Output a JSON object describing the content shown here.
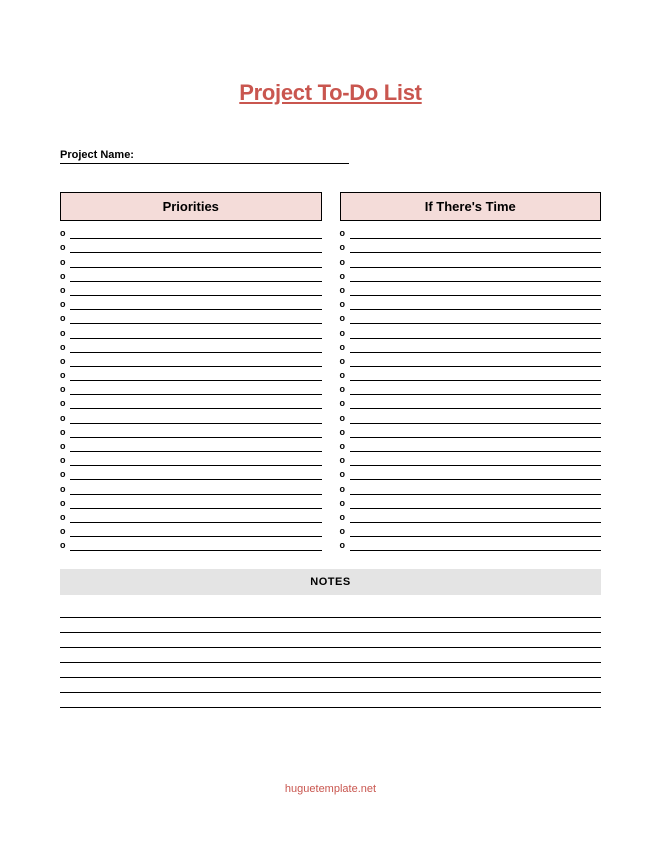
{
  "title": "Project To-Do List",
  "projectNameLabel": "Project Name:",
  "columns": {
    "left": {
      "header": "Priorities",
      "rows": [
        "o",
        "o",
        "o",
        "o",
        "o",
        "o",
        "o",
        "o",
        "o",
        "o",
        "o",
        "o",
        "o",
        "o",
        "o",
        "o",
        "o",
        "o",
        "o",
        "o",
        "o",
        "o",
        "o"
      ]
    },
    "right": {
      "header": "If There's Time",
      "rows": [
        "o",
        "o",
        "o",
        "o",
        "o",
        "o",
        "o",
        "o",
        "o",
        "o",
        "o",
        "o",
        "o",
        "o",
        "o",
        "o",
        "o",
        "o",
        "o",
        "o",
        "o",
        "o",
        "o"
      ]
    }
  },
  "notesHeader": "NOTES",
  "notesLineCount": 7,
  "footer": "huguetemplate.net"
}
